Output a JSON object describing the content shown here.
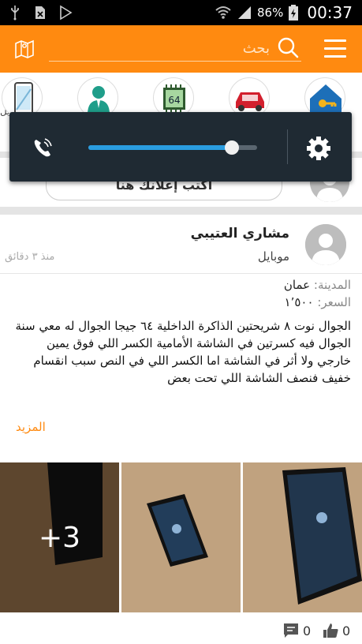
{
  "status_bar": {
    "battery_percent": "86%",
    "time": "00:37",
    "icons": [
      "usb-icon",
      "sim-off-icon",
      "play-store-icon",
      "wifi-icon",
      "signal-icon",
      "battery-charging-icon"
    ]
  },
  "appbar": {
    "search_placeholder": "بحث",
    "accent_color": "#ff8a10",
    "icons": [
      "map-icon",
      "search-icon",
      "menu-icon"
    ]
  },
  "categories": {
    "partial_label": "بايل",
    "icons": [
      "mobile-category-icon",
      "jobs-category-icon",
      "electronics-category-icon",
      "cars-category-icon",
      "real-estate-category-icon"
    ]
  },
  "post_ad": {
    "label": "أكتب إعلانك هنا"
  },
  "volume_popup": {
    "level": 0.85,
    "icons": [
      "call-volume-icon",
      "settings-gear-icon"
    ]
  },
  "post": {
    "author": "مشاري العتيبي",
    "category": "موبايل",
    "time": "منذ ٣ دقائق",
    "city_label": "المدينة:",
    "city_value": "عمان",
    "price_label": "السعر:",
    "price_value": "١٬٥٠٠",
    "description": "الجوال نوت ٨ شريحتين الذاكرة الداخلية ٦٤ جيجا الجوال له معي سنة\nالجوال فيه كسرتين في الشاشة الأمامية الكسر اللي فوق يمين خارجي ولا أثر في الشاشة اما الكسر اللي في النص سبب انقسام خفيف فنصف الشاشة اللي تحت بعض",
    "more_label": "المزيد",
    "extra_photos": "+3",
    "comments_count": "0",
    "likes_count": "0"
  }
}
